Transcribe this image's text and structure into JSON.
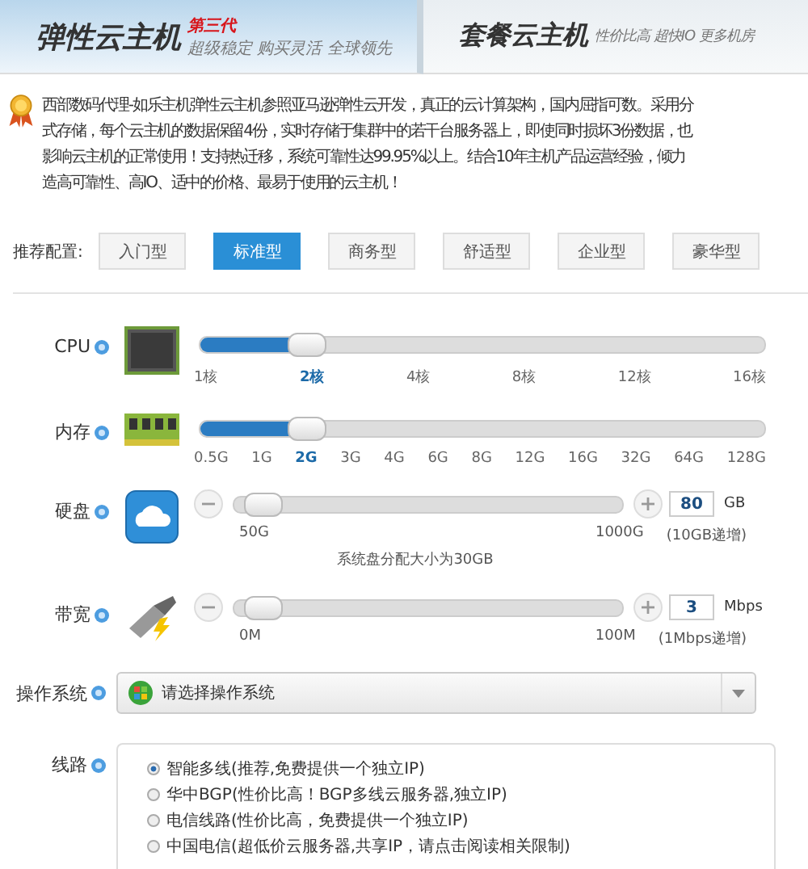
{
  "tabs": [
    {
      "title": "弹性云主机",
      "badge": "第三代",
      "subtitle": "超级稳定 购买灵活 全球领先",
      "selected": true
    },
    {
      "title": "套餐云主机",
      "subtitle": "性价比高 超快IO 更多机房",
      "selected": false
    }
  ],
  "intro": [
    "西部数码代理-如乐主机弹性云主机参照亚马逊弹性云开发，真正的云计算架构，国内屈指可数。采用分",
    "式存储，每个云主机的数据保留4份，实时存储于集群中的若干台服务器上，即使同时损坏3份数据，也",
    "影响云主机的正常使用！支持热迁移，系统可靠性达99.95%以上。结合10年主机产品运营经验，倾力",
    "造高可靠性、高IO、适中的价格、最易于使用的云主机！"
  ],
  "presets": {
    "label": "推荐配置:",
    "options": [
      {
        "label": "入门型",
        "selected": false
      },
      {
        "label": "标准型",
        "selected": true
      },
      {
        "label": "商务型",
        "selected": false
      },
      {
        "label": "舒适型",
        "selected": false
      },
      {
        "label": "企业型",
        "selected": false
      },
      {
        "label": "豪华型",
        "selected": false
      }
    ]
  },
  "resources": [
    {
      "kind": "ticks",
      "label": "CPU",
      "level": 0.19,
      "ticks": [
        {
          "text": "1核",
          "selected": false
        },
        {
          "text": "2核",
          "selected": true
        },
        {
          "text": "4核",
          "selected": false
        },
        {
          "text": "8核",
          "selected": false
        },
        {
          "text": "12核",
          "selected": false
        },
        {
          "text": "16核",
          "selected": false
        }
      ]
    },
    {
      "kind": "ticks",
      "label": "内存",
      "level": 0.19,
      "ticks": [
        {
          "text": "0.5G",
          "selected": false
        },
        {
          "text": "1G",
          "selected": false
        },
        {
          "text": "2G",
          "selected": true
        },
        {
          "text": "3G",
          "selected": false
        },
        {
          "text": "4G",
          "selected": false
        },
        {
          "text": "6G",
          "selected": false
        },
        {
          "text": "8G",
          "selected": false
        },
        {
          "text": "12G",
          "selected": false
        },
        {
          "text": "16G",
          "selected": false
        },
        {
          "text": "32G",
          "selected": false
        },
        {
          "text": "64G",
          "selected": false
        },
        {
          "text": "128G",
          "selected": false
        }
      ]
    },
    {
      "kind": "stepper",
      "label": "硬盘",
      "level": 0.04,
      "min": "50G",
      "max": "1000G",
      "value": "80",
      "unit": "GB",
      "step": "(10GB递增)",
      "note": "系统盘分配大小为30GB"
    },
    {
      "kind": "stepper",
      "label": "带宽",
      "level": 0.04,
      "min": "0M",
      "max": "100M",
      "value": "3",
      "unit": "Mbps",
      "step": "(1Mbps递增)"
    }
  ],
  "os": {
    "label": "操作系统",
    "placeholder": "请选择操作系统"
  },
  "line": {
    "label": "线路",
    "options": [
      {
        "label": "智能多线(推荐,免费提供一个独立IP)",
        "selected": true
      },
      {
        "label": "华中BGP(性价比高！BGP多线云服务器,独立IP)",
        "selected": false
      },
      {
        "label": "电信线路(性价比高，免费提供一个独立IP)",
        "selected": false
      },
      {
        "label": "中国电信(超低价云服务器,共享IP，请点击阅读相关限制)",
        "selected": false
      }
    ]
  }
}
